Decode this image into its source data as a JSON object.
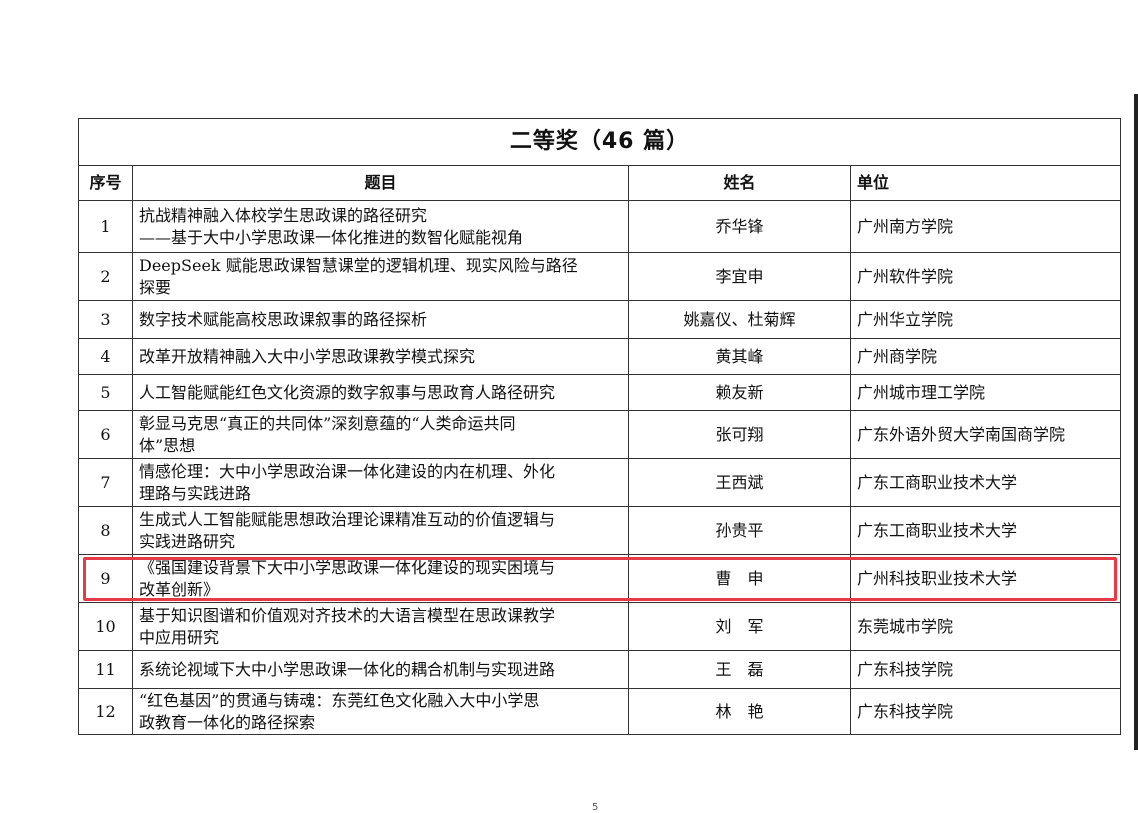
{
  "table": {
    "title": "二等奖（46 篇）",
    "headers": {
      "index": "序号",
      "topic": "题目",
      "name": "姓名",
      "unit": "单位"
    },
    "rows": [
      {
        "index": "1",
        "topic_lines": [
          "抗战精神融入体校学生思政课的路径研究",
          "——基于大中小学思政课一体化推进的数智化赋能视角"
        ],
        "name": "乔华锋",
        "unit": "广州南方学院"
      },
      {
        "index": "2",
        "topic_lines": [
          "DeepSeek 赋能思政课智慧课堂的逻辑机理、现实风险与路径",
          "探要"
        ],
        "name": "李宜申",
        "unit": "广州软件学院"
      },
      {
        "index": "3",
        "topic_lines": [
          "数字技术赋能高校思政课叙事的路径探析"
        ],
        "name": "姚嘉仪、杜菊辉",
        "unit": "广州华立学院"
      },
      {
        "index": "4",
        "topic_lines": [
          "改革开放精神融入大中小学思政课教学模式探究"
        ],
        "name": "黄其峰",
        "unit": "广州商学院"
      },
      {
        "index": "5",
        "topic_lines": [
          "人工智能赋能红色文化资源的数字叙事与思政育人路径研究"
        ],
        "name": "赖友新",
        "unit": "广州城市理工学院"
      },
      {
        "index": "6",
        "topic_lines": [
          "彰显马克思“真正的共同体”深刻意蕴的“人类命运共同",
          "体”思想"
        ],
        "name": "张可翔",
        "unit": "广东外语外贸大学南国商学院"
      },
      {
        "index": "7",
        "topic_lines": [
          "情感伦理：大中小学思政治课一体化建设的内在机理、外化",
          "理路与实践进路"
        ],
        "name": "王西斌",
        "unit": "广东工商职业技术大学"
      },
      {
        "index": "8",
        "topic_lines": [
          "生成式人工智能赋能思想政治理论课精准互动的价值逻辑与",
          "实践进路研究"
        ],
        "name": "孙贵平",
        "unit": "广东工商职业技术大学"
      },
      {
        "index": "9",
        "topic_lines": [
          "《强国建设背景下大中小学思政课一体化建设的现实困境与",
          "改革创新》"
        ],
        "name": "曹　申",
        "unit": "广州科技职业技术大学"
      },
      {
        "index": "10",
        "topic_lines": [
          "基于知识图谱和价值观对齐技术的大语言模型在思政课教学",
          "中应用研究"
        ],
        "name": "刘　军",
        "unit": "东莞城市学院"
      },
      {
        "index": "11",
        "topic_lines": [
          "系统论视域下大中小学思政课一体化的耦合机制与实现进路"
        ],
        "name": "王　磊",
        "unit": "广东科技学院"
      },
      {
        "index": "12",
        "topic_lines": [
          "“红色基因”的贯通与铸魂：东莞红色文化融入大中小学思",
          "政教育一体化的路径探索"
        ],
        "name": "林　艳",
        "unit": "广东科技学院"
      }
    ]
  },
  "highlight": {
    "row_index": "9",
    "color": "#e53b46"
  },
  "footer": {
    "page_number": "5"
  }
}
